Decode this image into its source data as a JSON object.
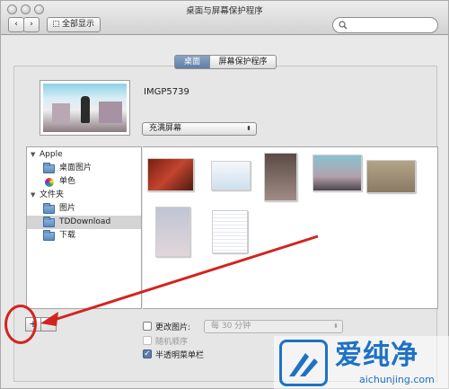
{
  "window": {
    "title": "桌面与屏幕保护程序"
  },
  "toolbar": {
    "show_all_label": "全部显示",
    "search_placeholder": ""
  },
  "tabs": [
    {
      "label": "桌面",
      "selected": true
    },
    {
      "label": "屏幕保护程序",
      "selected": false
    }
  ],
  "current": {
    "image_name": "IMGP5739",
    "fit_mode": "充满屏幕"
  },
  "sidebar": {
    "groups": [
      {
        "label": "Apple",
        "items": [
          {
            "label": "桌面图片",
            "icon": "folder-icon"
          },
          {
            "label": "单色",
            "icon": "color-wheel-icon"
          }
        ]
      },
      {
        "label": "文件夹",
        "items": [
          {
            "label": "图片",
            "icon": "folder-icon"
          },
          {
            "label": "TDDownload",
            "icon": "folder-icon",
            "selected": true
          },
          {
            "label": "下载",
            "icon": "folder-icon"
          }
        ]
      }
    ]
  },
  "buttons": {
    "add_label": "+",
    "remove_label": "−"
  },
  "options": {
    "change_picture_label": "更改图片:",
    "change_picture_checked": false,
    "interval_value": "每 30 分钟",
    "random_order_label": "随机顺序",
    "random_order_checked": false,
    "translucent_menubar_label": "半透明菜单栏",
    "translucent_menubar_checked": true,
    "check_mark": "✓"
  },
  "watermark": {
    "title": "爱纯净",
    "url": "aichunjing.com",
    "color": "#1d72c4"
  },
  "annotation": {
    "color": "#d2241f"
  }
}
